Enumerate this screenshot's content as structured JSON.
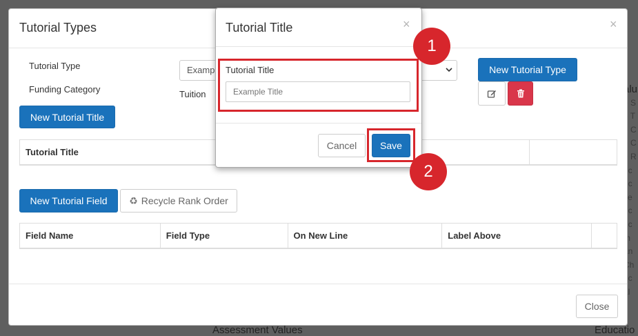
{
  "background": {
    "right_heading": "alu",
    "right_column": [
      "e S",
      "e T",
      "e C",
      "e C",
      "e R",
      "nc",
      "nc",
      "ce",
      "nc",
      "nc",
      "m",
      "an",
      "Ch",
      "nc",
      "al"
    ],
    "bottom_left": "Assessment Values",
    "bottom_right": "Educatio"
  },
  "main_modal": {
    "title": "Tutorial Types",
    "close_glyph": "×",
    "tutorial_type_label": "Tutorial Type",
    "tutorial_type_value": "Examp",
    "funding_category_label": "Funding Category",
    "funding_category_value": "Tuition",
    "new_tutorial_type_label": "New Tutorial Type",
    "edit_icon": "pencil-square",
    "delete_icon": "trash",
    "new_tutorial_title_label": "New Tutorial Title",
    "titles_table": {
      "headers": [
        "Tutorial Title",
        "",
        "",
        ""
      ]
    },
    "new_tutorial_field_label": "New Tutorial Field",
    "recycle_icon": "♻",
    "recycle_label": "Recycle Rank Order",
    "fields_table": {
      "headers": [
        "Field Name",
        "Field Type",
        "On New Line",
        "Label Above",
        ""
      ]
    },
    "close_button_label": "Close"
  },
  "dialog": {
    "title": "Tutorial Title",
    "close_glyph": "×",
    "field_label": "Tutorial Title",
    "field_placeholder": "Example Title",
    "cancel_label": "Cancel",
    "save_label": "Save"
  },
  "annotations": {
    "color": "#d7262c",
    "steps": [
      "1",
      "2"
    ]
  }
}
